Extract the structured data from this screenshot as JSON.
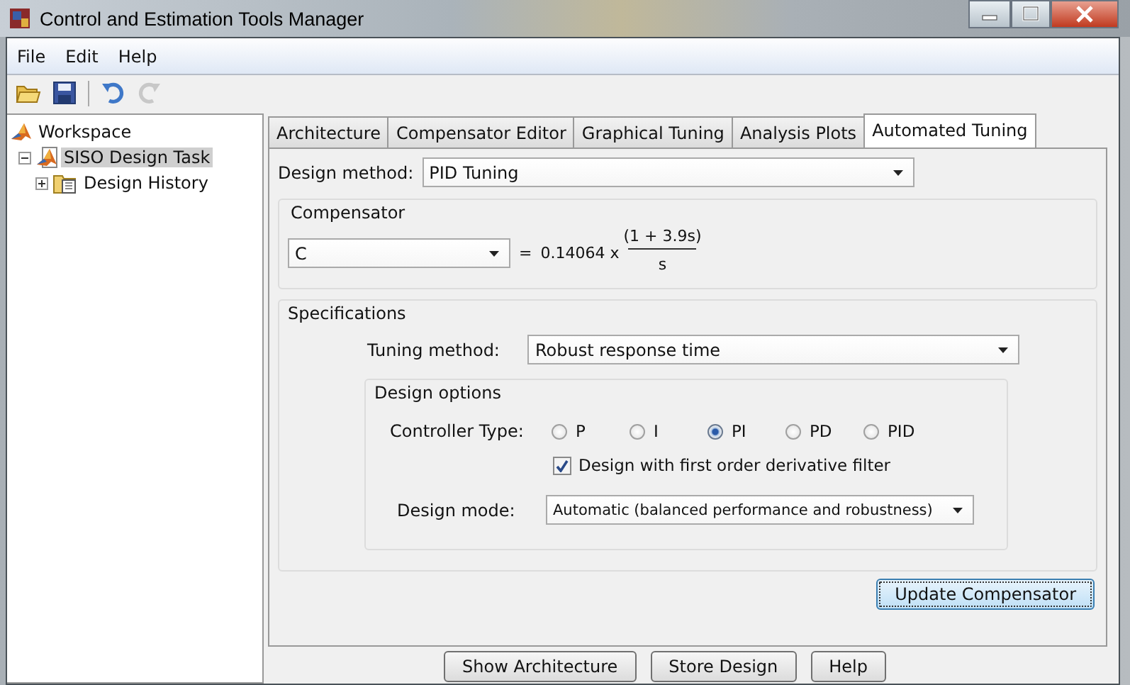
{
  "window": {
    "title": "Control and Estimation Tools Manager"
  },
  "menu": [
    "File",
    "Edit",
    "Help"
  ],
  "toolbar": [
    {
      "kind": "open",
      "disabled": false
    },
    {
      "kind": "save",
      "disabled": false
    },
    {
      "kind": "undo",
      "disabled": false
    },
    {
      "kind": "redo",
      "disabled": true
    }
  ],
  "tree": [
    {
      "label": "Workspace",
      "selected": false,
      "children": [
        {
          "label": "SISO Design Task",
          "selected": true,
          "expanded": true,
          "children": [
            {
              "label": "Design History",
              "selected": false,
              "expanded": false
            }
          ]
        }
      ]
    }
  ],
  "tabs": [
    {
      "label": "Architecture",
      "selected": false
    },
    {
      "label": "Compensator Editor",
      "selected": false
    },
    {
      "label": "Graphical Tuning",
      "selected": false
    },
    {
      "label": "Analysis Plots",
      "selected": false
    },
    {
      "label": "Automated Tuning",
      "selected": true
    }
  ],
  "design_method": {
    "label": "Design method:",
    "value": "PID Tuning"
  },
  "compensator": {
    "title": "Compensator",
    "selector": "C",
    "equals": "=",
    "gain": "0.14064 x",
    "numerator": "(1 + 3.9s)",
    "denominator": "s"
  },
  "specifications": {
    "title": "Specifications",
    "tuning_method": {
      "label": "Tuning method:",
      "value": "Robust response time"
    },
    "design_options": {
      "title": "Design options",
      "controller_type": {
        "label": "Controller Type:",
        "options": [
          {
            "label": "P",
            "selected": false
          },
          {
            "label": "I",
            "selected": false
          },
          {
            "label": "PI",
            "selected": true
          },
          {
            "label": "PD",
            "selected": false
          },
          {
            "label": "PID",
            "selected": false
          }
        ]
      },
      "filter": {
        "label": "Design with first order derivative filter",
        "checked": true
      },
      "design_mode": {
        "label": "Design mode:",
        "value": "Automatic (balanced performance and robustness)"
      }
    }
  },
  "update_button": "Update Compensator",
  "buttons": [
    "Show Architecture",
    "Store Design",
    "Help"
  ]
}
